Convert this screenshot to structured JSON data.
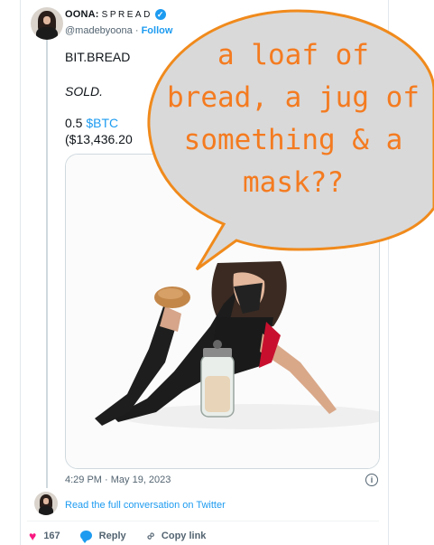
{
  "tweet": {
    "display_name": "OONA:",
    "display_name_suffix": "SPREAD",
    "handle": "@madebyoona",
    "separator": "·",
    "follow_label": "Follow",
    "lines": {
      "title": "BIT.BREAD",
      "status": "SOLD.",
      "price_amount": "0.5 ",
      "price_cashtag": "$BTC",
      "price_usd": "($13,436.20"
    },
    "time": "4:29 PM · May 19, 2023",
    "info_icon": "info-icon",
    "read_full": "Read the full conversation on Twitter",
    "actions": {
      "likes_count": "167",
      "reply_label": "Reply",
      "copy_label": "Copy link"
    }
  },
  "overlay": {
    "bubble_text_lines": [
      "a loaf of",
      "bread, a jug of",
      "something & a",
      "mask??"
    ],
    "bubble_fill": "#d9d9d9",
    "bubble_stroke": "#f08a1c",
    "text_color": "#f47b20"
  },
  "colors": {
    "link": "#1d9bf0",
    "like": "#f91880",
    "muted": "#536471"
  }
}
